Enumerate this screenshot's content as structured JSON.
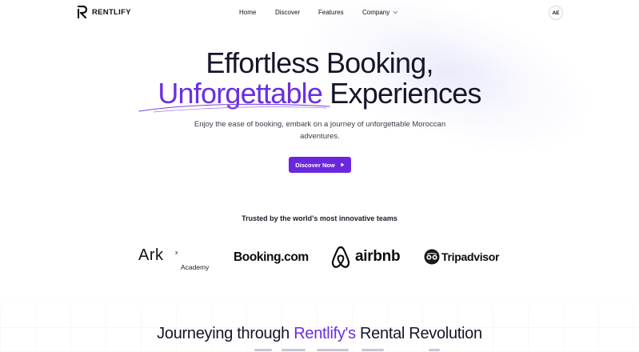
{
  "nav": {
    "brand": "RENTLIFY",
    "links": [
      "Home",
      "Discover",
      "Features",
      "Company"
    ],
    "avatar_initials": "AE"
  },
  "hero": {
    "line1": "Effortless Booking,",
    "line2_accent": "Unforgettable",
    "line2_rest": " Experiences",
    "subtitle": "Enjoy the ease of booking, embark on a journey of unforgettable Moroccan adventures.",
    "cta_label": "Discover Now"
  },
  "trusted": {
    "heading": "Trusted by the world’s most innovative teams",
    "logos": {
      "ark": "Ark",
      "ark_x": "x",
      "ark_sub": "Academy",
      "booking": "Booking.com",
      "airbnb": "airbnb",
      "tripadvisor": "Tripadvisor"
    }
  },
  "section": {
    "title_pre": "Journeying through ",
    "title_accent": "Rentlify's",
    "title_post": " Rental Revolution"
  },
  "colors": {
    "accent": "#6b2ee0",
    "cta_bg": "#6a28de",
    "text_dark": "#16162a"
  },
  "icons": [
    "rentlify-logo-icon",
    "chevron-down-icon",
    "play-arrow-icon",
    "airbnb-logo-icon",
    "tripadvisor-owl-icon"
  ]
}
